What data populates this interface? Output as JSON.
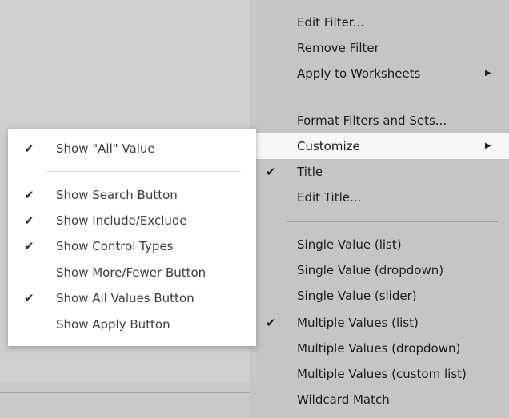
{
  "main_menu": {
    "items": [
      {
        "label": "Edit Filter...",
        "checked": false,
        "submenu": false
      },
      {
        "label": "Remove Filter",
        "checked": false,
        "submenu": false
      },
      {
        "label": "Apply to Worksheets",
        "checked": false,
        "submenu": true
      },
      {
        "label": "Format Filters and Sets...",
        "checked": false,
        "submenu": false
      },
      {
        "label": "Customize",
        "checked": false,
        "submenu": true,
        "highlighted": true
      },
      {
        "label": "Title",
        "checked": true,
        "submenu": false
      },
      {
        "label": "Edit Title...",
        "checked": false,
        "submenu": false
      },
      {
        "label": "Single Value (list)",
        "checked": false,
        "submenu": false
      },
      {
        "label": "Single Value (dropdown)",
        "checked": false,
        "submenu": false
      },
      {
        "label": "Single Value (slider)",
        "checked": false,
        "submenu": false
      },
      {
        "label": "Multiple Values (list)",
        "checked": true,
        "submenu": false
      },
      {
        "label": "Multiple Values (dropdown)",
        "checked": false,
        "submenu": false
      },
      {
        "label": "Multiple Values (custom list)",
        "checked": false,
        "submenu": false
      },
      {
        "label": "Wildcard Match",
        "checked": false,
        "submenu": false
      }
    ]
  },
  "customize_submenu": {
    "items": [
      {
        "label": "Show \"All\" Value",
        "checked": true
      },
      {
        "label": "Show Search Button",
        "checked": true
      },
      {
        "label": "Show Include/Exclude",
        "checked": true
      },
      {
        "label": "Show Control Types",
        "checked": true
      },
      {
        "label": "Show More/Fewer Button",
        "checked": false
      },
      {
        "label": "Show All Values Button",
        "checked": true
      },
      {
        "label": "Show Apply Button",
        "checked": false
      }
    ]
  },
  "glyphs": {
    "check": "✔",
    "submenu_arrow": "▶"
  },
  "colors": {
    "menu_background": "#c5c5c5",
    "highlight_background": "#f7f7f7",
    "submenu_background": "#ffffff",
    "workspace_background": "#cfcfcf"
  }
}
